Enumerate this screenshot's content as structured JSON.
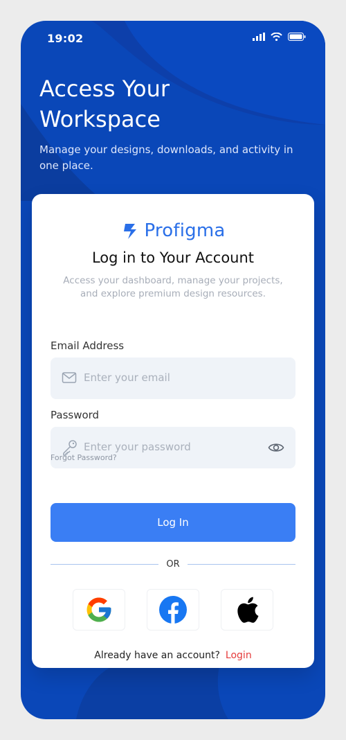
{
  "status": {
    "time": "19:02"
  },
  "hero": {
    "title_line1": "Access Your",
    "title_line2": "Workspace",
    "subtitle": "Manage your designs, downloads, and activity in one place."
  },
  "card": {
    "brand": "Profigma",
    "title": "Log in to Your Account",
    "description": "Access your dashboard, manage your projects, and explore premium design resources.",
    "email": {
      "label": "Email Address",
      "placeholder": "Enter your email"
    },
    "password": {
      "label": "Password",
      "placeholder": "Enter your password"
    },
    "forgot": "Forgot Password?",
    "login_button": "Log In",
    "or": "OR",
    "footer_text": "Already have an account?",
    "footer_link": "Login"
  },
  "colors": {
    "primary": "#3a7ef4",
    "background": "#0a47b8",
    "link": "#e53a3a"
  }
}
